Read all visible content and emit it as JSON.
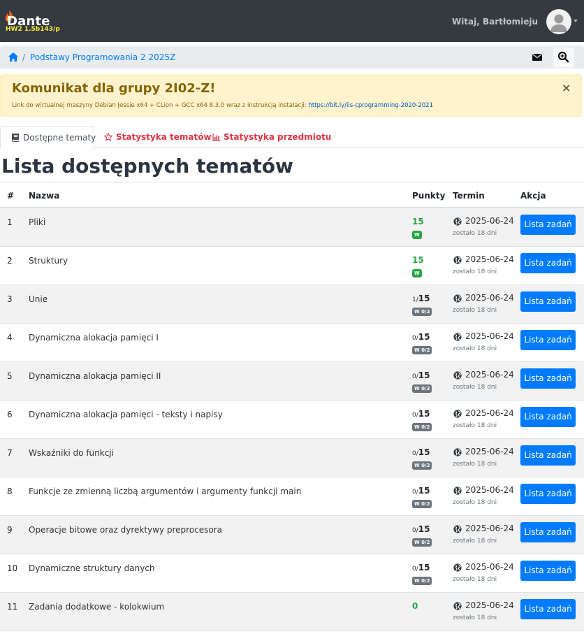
{
  "navbar": {
    "brand": "Dante",
    "version": "HW2 1.5b143/p",
    "greeting": "Witaj, Bartłomieju"
  },
  "breadcrumb": {
    "separator": "/",
    "course": "Podstawy Programowania 2 2025Z"
  },
  "alert": {
    "title": "Komunikat dla grupy 2I02-Z!",
    "text": "Link do wirtualnej maszyny Debian Jessie x64 + CLion + GCC x64 8.3.0 wraz z instrukcją instalacji: ",
    "link": "https://bit.ly/iis-cprogramming-2020-2021",
    "close": "×"
  },
  "tabs": [
    {
      "label": "Dostępne tematy"
    },
    {
      "label": "Statystyka tematów"
    },
    {
      "label": "Statystyka przedmiotu"
    }
  ],
  "page_title": "Lista dostępnych tematów",
  "table": {
    "headers": {
      "num": "#",
      "name": "Nazwa",
      "points": "Punkty",
      "deadline": "Termin",
      "action": "Akcja"
    },
    "rows": [
      {
        "num": "1",
        "name": "Pliki",
        "got": "",
        "max": "15",
        "badge": "W",
        "complete": true,
        "date": "2025-06-24",
        "left": "zostało 18 dni",
        "action": "Lista zadań"
      },
      {
        "num": "2",
        "name": "Struktury",
        "got": "",
        "max": "15",
        "badge": "W",
        "complete": true,
        "date": "2025-06-24",
        "left": "zostało 18 dni",
        "action": "Lista zadań"
      },
      {
        "num": "3",
        "name": "Unie",
        "got": "1/",
        "max": "15",
        "badge": "W 0/2",
        "complete": false,
        "date": "2025-06-24",
        "left": "zostało 18 dni",
        "action": "Lista zadań"
      },
      {
        "num": "4",
        "name": "Dynamiczna alokacja pamięci I",
        "got": "0/",
        "max": "15",
        "badge": "W 0/2",
        "complete": false,
        "date": "2025-06-24",
        "left": "zostało 18 dni",
        "action": "Lista zadań"
      },
      {
        "num": "5",
        "name": "Dynamiczna alokacja pamięci II",
        "got": "0/",
        "max": "15",
        "badge": "W 0/2",
        "complete": false,
        "date": "2025-06-24",
        "left": "zostało 18 dni",
        "action": "Lista zadań"
      },
      {
        "num": "6",
        "name": "Dynamiczna alokacja pamięci - teksty i napisy",
        "got": "0/",
        "max": "15",
        "badge": "W 0/2",
        "complete": false,
        "date": "2025-06-24",
        "left": "zostało 18 dni",
        "action": "Lista zadań"
      },
      {
        "num": "7",
        "name": "Wskaźniki do funkcji",
        "got": "0/",
        "max": "15",
        "badge": "W 0/2",
        "complete": false,
        "date": "2025-06-24",
        "left": "zostało 18 dni",
        "action": "Lista zadań"
      },
      {
        "num": "8",
        "name": "Funkcje ze zmienną liczbą argumentów i argumenty funkcji main",
        "got": "0/",
        "max": "15",
        "badge": "W 0/2",
        "complete": false,
        "date": "2025-06-24",
        "left": "zostało 18 dni",
        "action": "Lista zadań"
      },
      {
        "num": "9",
        "name": "Operacje bitowe oraz dyrektywy preprocesora",
        "got": "0/",
        "max": "15",
        "badge": "W 0/2",
        "complete": false,
        "date": "2025-06-24",
        "left": "zostało 18 dni",
        "action": "Lista zadań"
      },
      {
        "num": "10",
        "name": "Dynamiczne struktury danych",
        "got": "0/",
        "max": "15",
        "badge": "W 0/2",
        "complete": false,
        "date": "2025-06-24",
        "left": "zostało 18 dni",
        "action": "Lista zadań"
      },
      {
        "num": "11",
        "name": "Zadania dodatkowe - kolokwium",
        "got": "",
        "max": "0",
        "badge": "",
        "complete": true,
        "date": "2025-06-24",
        "left": "zostało 18 dni",
        "action": "Lista zadań"
      }
    ]
  },
  "colors": {
    "navbar": "#343a40",
    "primary": "#007bff",
    "success": "#28a745",
    "danger": "#dc3545",
    "warning_bg": "#fff3cd"
  },
  "icons": [
    "flame-icon",
    "home-icon",
    "envelope-icon",
    "zoom-icon",
    "user-avatar-icon",
    "book-icon",
    "star-icon",
    "bar-chart-icon",
    "globe-icon"
  ]
}
